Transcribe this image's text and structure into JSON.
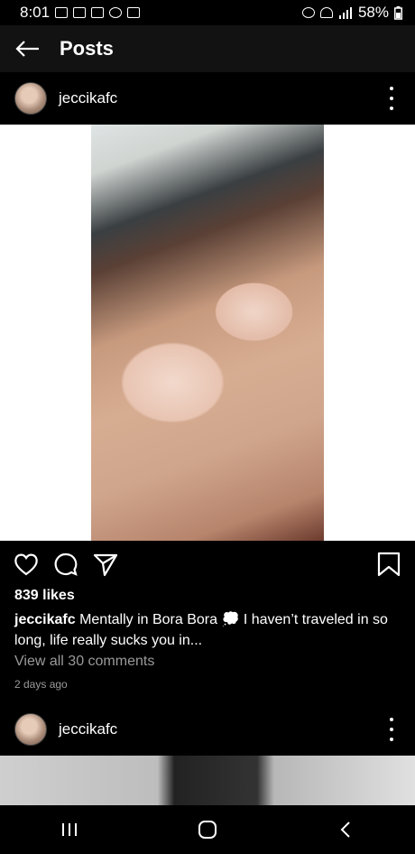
{
  "status": {
    "time": "8:01",
    "battery": "58%"
  },
  "header": {
    "title": "Posts"
  },
  "posts": [
    {
      "username": "jeccikafc",
      "likes": "839 likes",
      "caption_user": "jeccikafc",
      "caption_text": "Mentally in Bora Bora 💭 I haven’t traveled in so long, life really sucks you in...",
      "comments_link": "View all 30 comments",
      "posted": "2 days ago"
    },
    {
      "username": "jeccikafc"
    }
  ],
  "colors": {
    "background": "#000000",
    "topbar": "#121212",
    "secondary_text": "#9a9a9a"
  }
}
